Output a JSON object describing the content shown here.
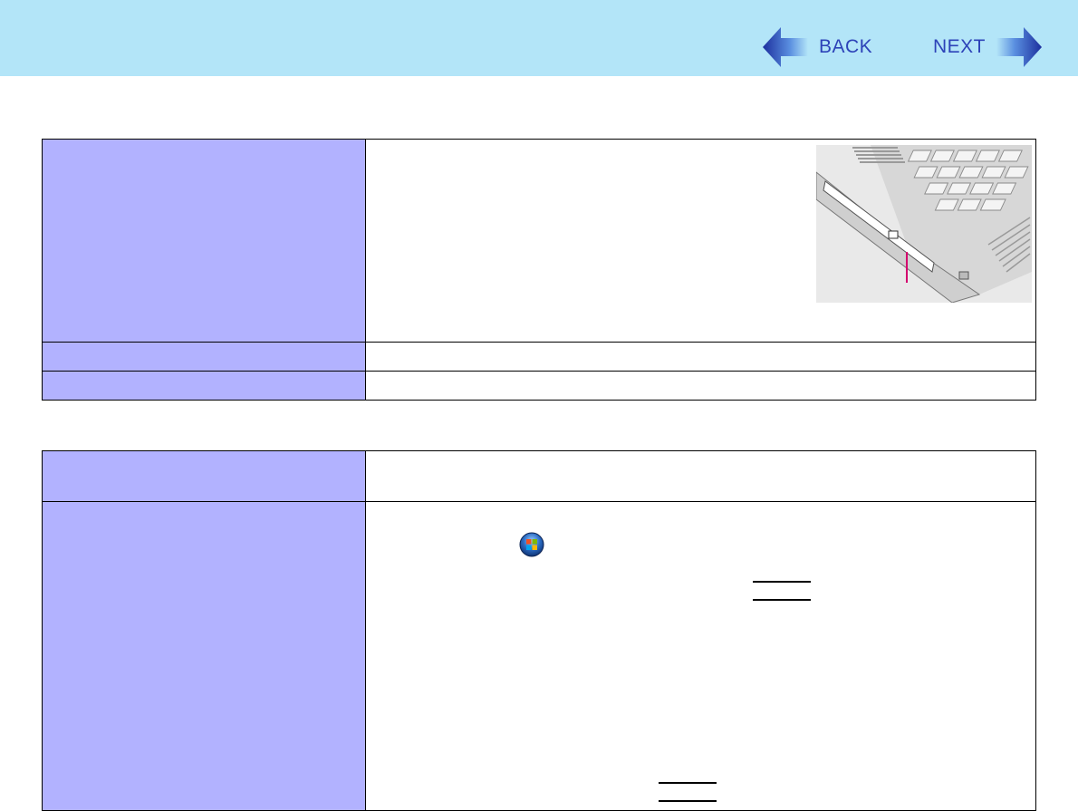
{
  "nav": {
    "back_label": "BACK",
    "next_label": "NEXT"
  },
  "colors": {
    "header_bg": "#b3e5f8",
    "key_cell_bg": "#b2b2ff",
    "arrow_blue": "#2d43b8",
    "indicator_line": "#d4006e"
  },
  "icons": [
    "back-arrow-icon",
    "next-arrow-icon",
    "windows-start-orb-icon"
  ]
}
